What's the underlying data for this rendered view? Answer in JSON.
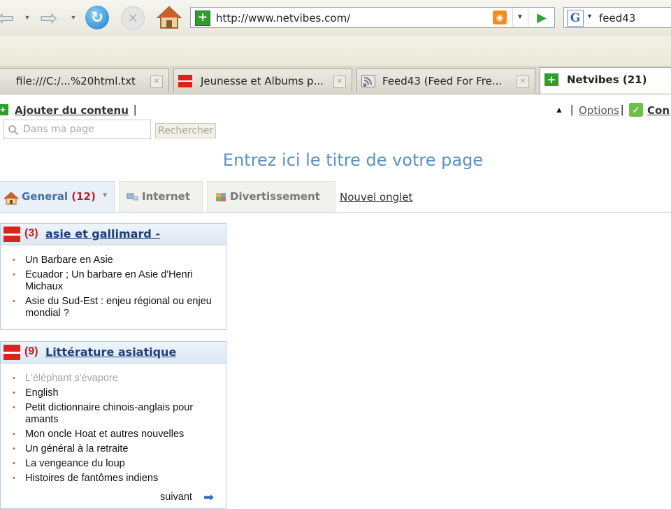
{
  "browser": {
    "url": "http://www.netvibes.com/",
    "search_query": "feed43",
    "search_engine_letter": "G",
    "tabs": [
      {
        "label": "file:///C:/...%20html.txt",
        "icon": "blank-page-icon",
        "active": false
      },
      {
        "label": "Jeunesse et Albums p...",
        "icon": "red-feed-icon",
        "active": false
      },
      {
        "label": "Feed43 (Feed For Fre...",
        "icon": "rss-icon",
        "active": false
      },
      {
        "label": "Netvibes (21)",
        "icon": "netvibes-icon",
        "active": true
      }
    ]
  },
  "header": {
    "add_content": "Ajouter du contenu",
    "separator": "|",
    "options": "Options",
    "connexion": "Con"
  },
  "search": {
    "placeholder": "Dans ma page",
    "button": "Rechercher"
  },
  "page_title": "Entrez ici le titre de votre page",
  "tabs": [
    {
      "label": "General",
      "count": "(12)",
      "icon": "home-icon",
      "active": true
    },
    {
      "label": "Internet",
      "icon": "internet-icon",
      "active": false
    },
    {
      "label": "Divertissement",
      "icon": "entertainment-icon",
      "active": false
    }
  ],
  "new_tab": "Nouvel onglet",
  "widgets": [
    {
      "count": "(3)",
      "title": "asie et gallimard -",
      "items": [
        {
          "text": "Un Barbare en Asie",
          "read": false
        },
        {
          "text": "Ecuador ; Un barbare en Asie d'Henri Michaux",
          "read": false
        },
        {
          "text": "Asie du Sud-Est : enjeu régional ou enjeu mondial ?",
          "read": false
        }
      ]
    },
    {
      "count": "(9)",
      "title": "Littérature asiatique",
      "items": [
        {
          "text": "L'éléphant s'évapore",
          "read": true
        },
        {
          "text": "English",
          "read": false
        },
        {
          "text": "Petit dictionnaire chinois-anglais pour amants",
          "read": false
        },
        {
          "text": "Mon oncle Hoat et autres nouvelles",
          "read": false
        },
        {
          "text": "Un général à la retraite",
          "read": false
        },
        {
          "text": "La vengeance du loup",
          "read": false
        },
        {
          "text": "Histoires de fantômes indiens",
          "read": false
        }
      ],
      "next": "suivant"
    }
  ],
  "colors": {
    "accent_blue": "#5b8fc1",
    "netvibes_green": "#2f9e2f",
    "feed_red": "#d8241c",
    "unread_count_red": "#bb2222"
  }
}
